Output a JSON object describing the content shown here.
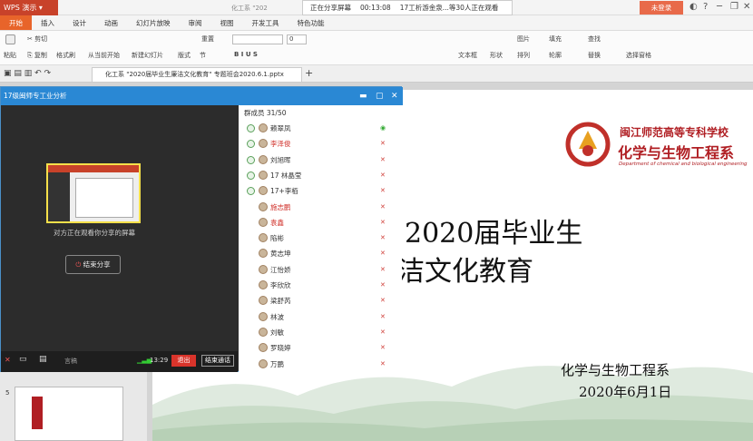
{
  "app": {
    "menu_label": "WPS 演示",
    "doc_tab": "化工系 \"202"
  },
  "share_bar": {
    "status": "正在分享屏幕",
    "timer": "00:13:08",
    "watchers": "17工析游金泉...等30人正在观看"
  },
  "login_label": "未登录",
  "tabs": [
    "开始",
    "插入",
    "设计",
    "动画",
    "幻灯片放映",
    "审阅",
    "视图",
    "开发工具",
    "特色功能"
  ],
  "ribbon": {
    "paste": "粘贴",
    "cut": "剪切",
    "copy": "复制",
    "format_painter": "格式刷",
    "from_current": "从当前开始",
    "new_slide": "新建幻灯片",
    "layout": "版式",
    "section": "节",
    "reset": "重置",
    "font_size": "0",
    "textbox": "文本框",
    "shape": "形状",
    "arrange": "排列",
    "outline": "轮廓",
    "picture": "图片",
    "fill": "填充",
    "find": "查找",
    "replace": "替换",
    "select_pane": "选择窗格"
  },
  "file_tab": "化工系 \"2020届毕业生廉洁文化教育\" 专题班会2020.6.1.pptx",
  "meeting": {
    "title": "17级闽师专工业分析",
    "preview_caption": "对方正在观看你分享的屏幕",
    "end_share": "结束分享",
    "mute_label": "言稿",
    "call_time": "13:29",
    "exit": "退出",
    "end_call": "结束通话",
    "member_count": "群成员 31/50",
    "members": [
      {
        "name": "赖翠凤",
        "red": false
      },
      {
        "name": "李泽俊",
        "red": true
      },
      {
        "name": "刘旭晖",
        "red": false
      },
      {
        "name": "17 林晶莹",
        "red": false
      },
      {
        "name": "17+李栢",
        "red": false
      },
      {
        "name": "施志鹏",
        "red": true
      },
      {
        "name": "袁鑫",
        "red": true
      },
      {
        "name": "陷彬",
        "red": false
      },
      {
        "name": "黄志坤",
        "red": false
      },
      {
        "name": "江怡娇",
        "red": false
      },
      {
        "name": "李欣欣",
        "red": false
      },
      {
        "name": "梁舒芮",
        "red": false
      },
      {
        "name": "林波",
        "red": false
      },
      {
        "name": "刘敏",
        "red": false
      },
      {
        "name": "罗晓婷",
        "red": false
      },
      {
        "name": "万鹏",
        "red": false
      }
    ]
  },
  "slide": {
    "school_name": "闽江师范高等专科学校",
    "dept_logo": "化学与生物工程系",
    "dept_en": "Department of chemical and biological engineering",
    "title_line1": "2020届毕业生",
    "title_line2": "洁文化教育",
    "department": "化学与生物工程系",
    "date": "2020年6月1日"
  },
  "thumb_index": "5",
  "colors": {
    "accent": "#e8642a",
    "brand_red": "#b01e23",
    "meeting_blue": "#2a88d4"
  }
}
